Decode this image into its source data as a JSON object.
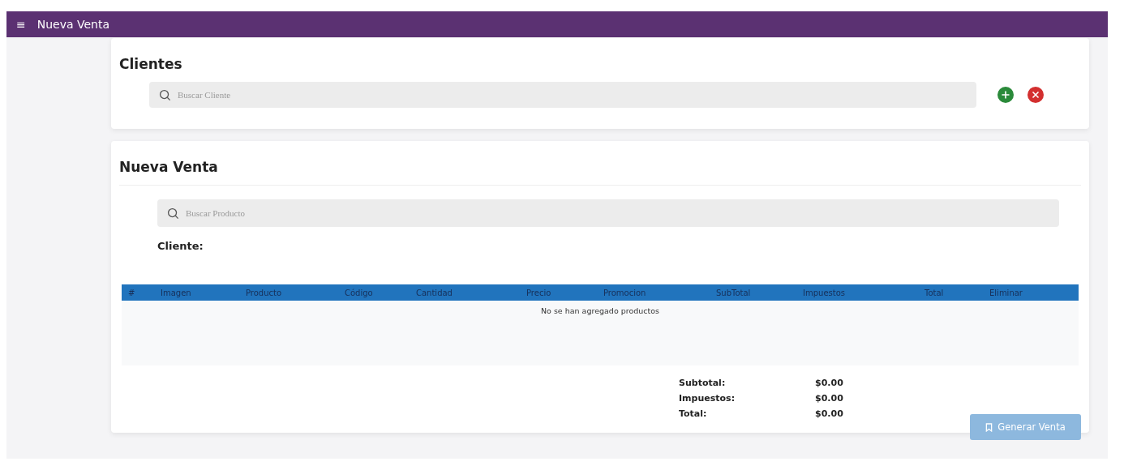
{
  "topbar": {
    "menu_icon": "≡",
    "title": "Nueva Venta"
  },
  "clientes": {
    "title": "Clientes",
    "search": {
      "placeholder": "Buscar Cliente"
    }
  },
  "venta": {
    "title": "Nueva Venta",
    "search": {
      "placeholder": "Buscar Producto"
    },
    "cliente_label": "Cliente:",
    "table": {
      "columns": [
        "#",
        "Imagen",
        "Producto",
        "Código",
        "Cantidad",
        "Precio",
        "Promocion",
        "SubTotal",
        "Impuestos",
        "Total",
        "Eliminar"
      ],
      "empty_message": "No se han agregado productos"
    },
    "totals": [
      {
        "label": "Subtotal:",
        "value": "$0.00"
      },
      {
        "label": "Impuestos:",
        "value": "$0.00"
      },
      {
        "label": "Total:",
        "value": "$0.00"
      }
    ],
    "generate_button": {
      "label": "Generar Venta",
      "disabled": true
    }
  }
}
